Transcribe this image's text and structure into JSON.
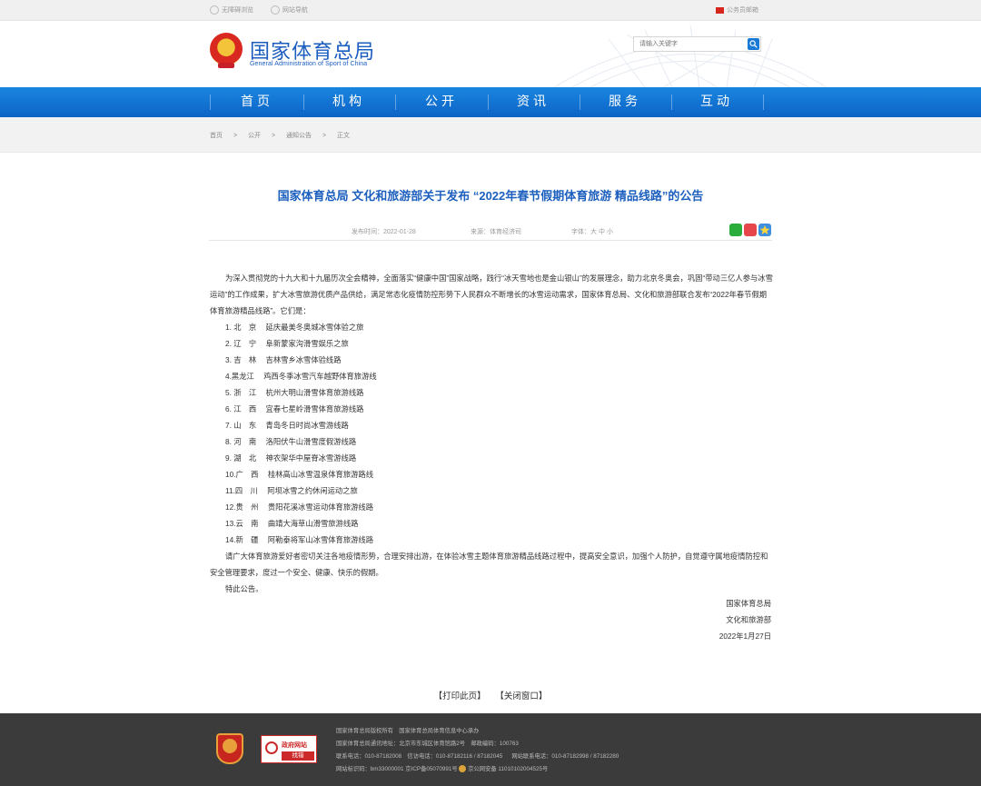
{
  "topbar": {
    "accessible_label": "无障碍浏览",
    "sitenav_label": "网站导航",
    "mail_label": "公务员邮箱"
  },
  "header": {
    "title_cn": "国家体育总局",
    "title_en": "General Administration of Sport of China",
    "search_placeholder": "请输入关键字"
  },
  "nav": [
    "首页",
    "机构",
    "公开",
    "资讯",
    "服务",
    "互动"
  ],
  "breadcrumb": [
    "首页",
    ">",
    "公开",
    ">",
    "通知公告",
    ">",
    "正文"
  ],
  "article": {
    "title": "国家体育总局 文化和旅游部关于发布 “2022年春节假期体育旅游 精品线路”的公告",
    "publish_time": "发布时间：2022-01-28",
    "source": "来源：体育经济司",
    "font_size": "字体：大 中 小",
    "intro": "为深入贯彻党的十九大和十九届历次全会精神，全面落实“健康中国”国家战略，践行“冰天雪地也是金山银山”的发展理念，助力北京冬奥会，巩固“带动三亿人参与冰雪运动”的工作成果，扩大冰雪旅游优质产品供给，满足常态化疫情防控形势下人民群众不断增长的冰雪运动需求，国家体育总局、文化和旅游部联合发布“2022年春节假期体育旅游精品线路”。它们是：",
    "routes": [
      {
        "no": "1.",
        "prov": "北　京",
        "route": "延庆最美冬奥城冰雪体验之旅"
      },
      {
        "no": "2.",
        "prov": "辽　宁",
        "route": "阜新蒙家沟滑雪娱乐之旅"
      },
      {
        "no": "3.",
        "prov": "吉　林",
        "route": "吉林雪乡冰雪体验线路"
      },
      {
        "no": "4.",
        "prov": "黑龙江",
        "route": "鸡西冬季冰雪汽车越野体育旅游线"
      },
      {
        "no": "5.",
        "prov": "浙　江",
        "route": "杭州大明山滑雪体育旅游线路"
      },
      {
        "no": "6.",
        "prov": "江　西",
        "route": "宜春七星岭滑雪体育旅游线路"
      },
      {
        "no": "7.",
        "prov": "山　东",
        "route": "青岛冬日时尚冰雪游线路"
      },
      {
        "no": "8.",
        "prov": "河　南",
        "route": "洛阳伏牛山滑雪度假游线路"
      },
      {
        "no": "9.",
        "prov": "湖　北",
        "route": "神农架华中屋脊冰雪游线路"
      },
      {
        "no": "10.",
        "prov": "广　西",
        "route": "桂林高山冰雪温泉体育旅游路线"
      },
      {
        "no": "11.",
        "prov": "四　川",
        "route": "阿坝冰雪之约休闲运动之旅"
      },
      {
        "no": "12.",
        "prov": "贵　州",
        "route": "贵阳花溪冰雪运动体育旅游线路"
      },
      {
        "no": "13.",
        "prov": "云　南",
        "route": "曲靖大海草山滑雪旅游线路"
      },
      {
        "no": "14.",
        "prov": "新　疆",
        "route": "阿勒泰将军山冰雪体育旅游线路"
      }
    ],
    "closing": "请广大体育旅游爱好者密切关注各地疫情形势，合理安排出游，在体验冰雪主题体育旅游精品线路过程中，提高安全意识，加强个人防护，自觉遵守属地疫情防控和安全管理要求，度过一个安全、健康、快乐的假期。",
    "notice": "特此公告。",
    "sign1": "国家体育总局",
    "sign2": "文化和旅游部",
    "date": "2022年1月27日"
  },
  "actions": {
    "print": "【打印此页】",
    "close": "【关闭窗口】"
  },
  "footer": {
    "gov_line1": "政府网站",
    "gov_line2": "找错",
    "line1": "国家体育总局版权所有　国家体育总局体育信息中心承办",
    "line2": "国家体育总局通讯地址：北京市东城区体育馆路2号　邮政编码：100763",
    "line3a": "联系电话：010-87182008　信访电话：010-87182116 / 87182045",
    "line3b": "网站联系电话：010-87182998 / 87182280",
    "line4a": "网站标识码：bm33000001 京ICP备05070991号",
    "line4b": "京公网安备 11010102004525号"
  }
}
